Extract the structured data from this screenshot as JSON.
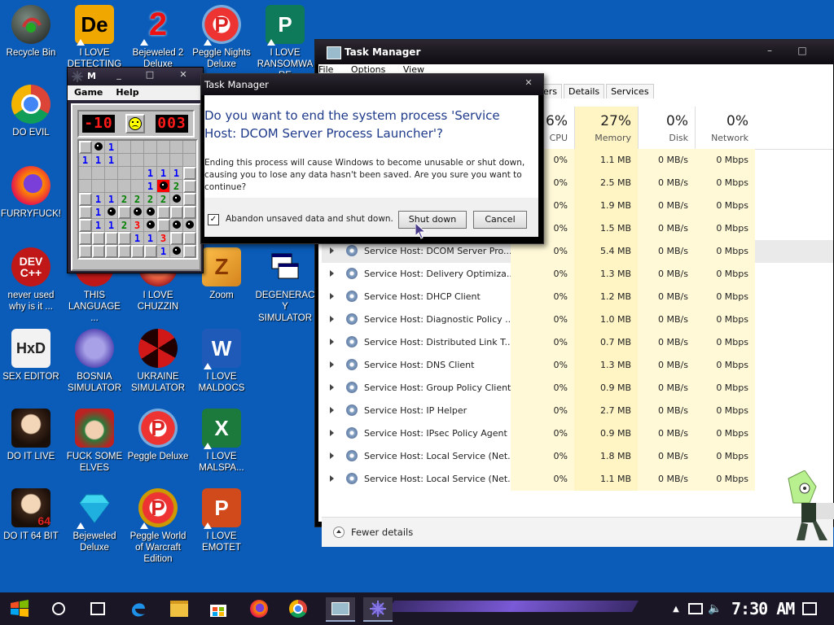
{
  "desktop": {
    "icons": [
      {
        "label": "Recycle Bin"
      },
      {
        "label": "I LOVE DETECTING"
      },
      {
        "label": "Bejeweled 2 Deluxe"
      },
      {
        "label": "Peggle Nights Deluxe"
      },
      {
        "label": "I LOVE RANSOMWARE"
      },
      {
        "label": "DO EVIL"
      },
      {
        "label": "FURRYFUCK!"
      },
      {
        "label": "never used why is it ..."
      },
      {
        "label": "THIS LANGUAGE ..."
      },
      {
        "label": "I LOVE CHUZZIN"
      },
      {
        "label": "Zoom"
      },
      {
        "label": "DEGENERACY SIMULATOR"
      },
      {
        "label": "SEX EDITOR"
      },
      {
        "label": "BOSNIA SIMULATOR"
      },
      {
        "label": "UKRAINE SIMULATOR"
      },
      {
        "label": "I LOVE MALDOCS"
      },
      {
        "label": "DO IT LIVE"
      },
      {
        "label": "FUCK SOME ELVES"
      },
      {
        "label": "Peggle Deluxe"
      },
      {
        "label": "I LOVE MALSPA..."
      },
      {
        "label": "DO IT 64 BIT"
      },
      {
        "label": "Bejeweled Deluxe"
      },
      {
        "label": "Peggle World of Warcraft Edition"
      },
      {
        "label": "I LOVE EMOTET"
      }
    ],
    "icon_glyphs": {
      "dev": "DEV C++",
      "de": "De",
      "two": "2",
      "p": "P",
      "w": "W",
      "x": "X",
      "pp": "P",
      "hxd": "HxD"
    }
  },
  "minesweeper": {
    "title": "M",
    "menu": [
      "Game",
      "Help"
    ],
    "mine_counter": "-10",
    "timer": "003",
    "grid": [
      [
        "h",
        "m",
        "1",
        "o",
        "o",
        "o",
        "o",
        "o",
        "o"
      ],
      [
        "1",
        "1",
        "1",
        "o",
        "o",
        "o",
        "o",
        "o",
        "o"
      ],
      [
        "o",
        "o",
        "o",
        "o",
        "o",
        "1",
        "1",
        "1",
        "h"
      ],
      [
        "o",
        "o",
        "o",
        "o",
        "o",
        "1",
        "x",
        "2",
        "h"
      ],
      [
        "h",
        "1",
        "1",
        "2",
        "2",
        "2",
        "2",
        "m",
        "h"
      ],
      [
        "h",
        "1",
        "m",
        "h",
        "m",
        "m",
        "h",
        "h",
        "h"
      ],
      [
        "h",
        "1",
        "1",
        "2",
        "3",
        "m",
        "h",
        "m",
        "m"
      ],
      [
        "h",
        "h",
        "h",
        "h",
        "1",
        "1",
        "3",
        "h",
        "h"
      ],
      [
        "h",
        "h",
        "h",
        "h",
        "h",
        "h",
        "1",
        "m",
        "h"
      ]
    ]
  },
  "taskmanager": {
    "title": "Task Manager",
    "menu": [
      "File",
      "Options",
      "View"
    ],
    "tabs": [
      "ers",
      "Details",
      "Services"
    ],
    "columns": [
      {
        "pct": "6%",
        "name": "CPU"
      },
      {
        "pct": "27%",
        "name": "Memory"
      },
      {
        "pct": "0%",
        "name": "Disk"
      },
      {
        "pct": "0%",
        "name": "Network"
      }
    ],
    "rows": [
      {
        "name": "",
        "cpu": "0%",
        "mem": "1.1 MB",
        "disk": "0 MB/s",
        "net": "0 Mbps"
      },
      {
        "name": "",
        "cpu": "0%",
        "mem": "2.5 MB",
        "disk": "0 MB/s",
        "net": "0 Mbps"
      },
      {
        "name": "",
        "cpu": "0%",
        "mem": "1.9 MB",
        "disk": "0 MB/s",
        "net": "0 Mbps"
      },
      {
        "name": "",
        "cpu": "0%",
        "mem": "1.5 MB",
        "disk": "0 MB/s",
        "net": "0 Mbps"
      },
      {
        "name": "Service Host: DCOM Server Pro...",
        "cpu": "0%",
        "mem": "5.4 MB",
        "disk": "0 MB/s",
        "net": "0 Mbps"
      },
      {
        "name": "Service Host: Delivery Optimiza...",
        "cpu": "0%",
        "mem": "1.3 MB",
        "disk": "0 MB/s",
        "net": "0 Mbps"
      },
      {
        "name": "Service Host: DHCP Client",
        "cpu": "0%",
        "mem": "1.2 MB",
        "disk": "0 MB/s",
        "net": "0 Mbps"
      },
      {
        "name": "Service Host: Diagnostic Policy ...",
        "cpu": "0%",
        "mem": "1.0 MB",
        "disk": "0 MB/s",
        "net": "0 Mbps"
      },
      {
        "name": "Service Host: Distributed Link T...",
        "cpu": "0%",
        "mem": "0.7 MB",
        "disk": "0 MB/s",
        "net": "0 Mbps"
      },
      {
        "name": "Service Host: DNS Client",
        "cpu": "0%",
        "mem": "1.3 MB",
        "disk": "0 MB/s",
        "net": "0 Mbps"
      },
      {
        "name": "Service Host: Group Policy Client",
        "cpu": "0%",
        "mem": "0.9 MB",
        "disk": "0 MB/s",
        "net": "0 Mbps"
      },
      {
        "name": "Service Host: IP Helper",
        "cpu": "0%",
        "mem": "2.7 MB",
        "disk": "0 MB/s",
        "net": "0 Mbps"
      },
      {
        "name": "Service Host: IPsec Policy Agent",
        "cpu": "0%",
        "mem": "0.9 MB",
        "disk": "0 MB/s",
        "net": "0 Mbps"
      },
      {
        "name": "Service Host: Local Service (Net...",
        "cpu": "0%",
        "mem": "1.8 MB",
        "disk": "0 MB/s",
        "net": "0 Mbps"
      },
      {
        "name": "Service Host: Local Service (Net...",
        "cpu": "0%",
        "mem": "1.1 MB",
        "disk": "0 MB/s",
        "net": "0 Mbps"
      }
    ],
    "fewer_details": "Fewer details"
  },
  "dialog": {
    "title": "Task Manager",
    "question": "Do you want to end the system process 'Service Host: DCOM Server Process Launcher'?",
    "description": "Ending this process will cause Windows to become unusable or shut down, causing you to lose any data hasn't been saved. Are you sure you want to continue?",
    "checkbox_label": "Abandon unsaved data and shut down.",
    "checkbox_mark": "✓",
    "shutdown_label": "Shut down",
    "cancel_label": "Cancel"
  },
  "taskbar": {
    "clock": "7:30 AM"
  }
}
